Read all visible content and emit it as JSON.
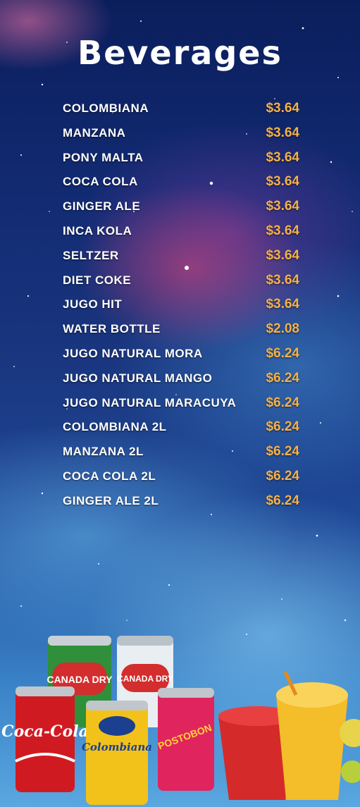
{
  "title": "Beverages",
  "items": [
    {
      "name": "COLOMBIANA",
      "price": "$3.64"
    },
    {
      "name": "MANZANA",
      "price": "$3.64"
    },
    {
      "name": "PONY  MALTA",
      "price": "$3.64"
    },
    {
      "name": "COCA  COLA",
      "price": "$3.64"
    },
    {
      "name": "GINGER  ALE",
      "price": "$3.64"
    },
    {
      "name": "INCA  KOLA",
      "price": "$3.64"
    },
    {
      "name": "SELTZER",
      "price": "$3.64"
    },
    {
      "name": "DIET COKE",
      "price": "$3.64"
    },
    {
      "name": "JUGO HIT",
      "price": "$3.64"
    },
    {
      "name": "WATER BOTTLE",
      "price": "$2.08"
    },
    {
      "name": "JUGO  NATURAL  MORA",
      "price": "$6.24"
    },
    {
      "name": "JUGO  NATURAL  MANGO",
      "price": "$6.24"
    },
    {
      "name": "JUGO  NATURAL  MARACUYA",
      "price": "$6.24"
    },
    {
      "name": "COLOMBIANA 2L",
      "price": "$6.24"
    },
    {
      "name": "MANZANA 2L",
      "price": "$6.24"
    },
    {
      "name": "COCA  COLA 2L",
      "price": "$6.24"
    },
    {
      "name": "GINGER  ALE  2L",
      "price": "$6.24"
    }
  ],
  "products": {
    "coca_cola": "Coca-Cola",
    "canada_dry": "CANADA DRY",
    "colombiana": "Colombiana",
    "postobon": "POSTOBON"
  },
  "colors": {
    "price": "#f4b14a",
    "item": "#ffffff"
  }
}
